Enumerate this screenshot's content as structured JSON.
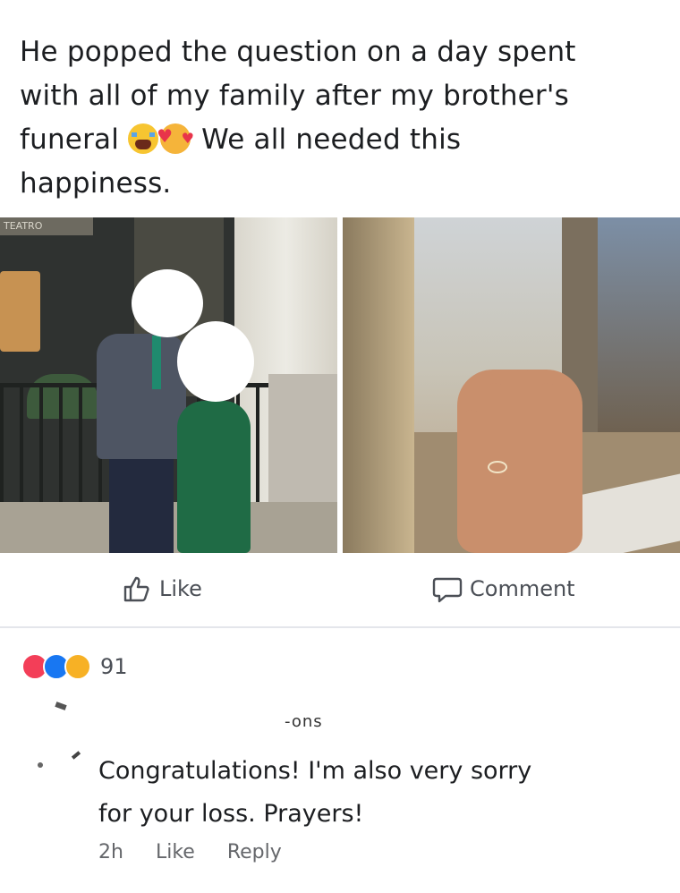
{
  "post": {
    "text_line1": "He popped the question on a day spent",
    "text_line2": "with all of my family after my brother's",
    "text_line3_a": "funeral",
    "text_line3_b": "We all needed this",
    "text_line4": "happiness.",
    "emoji_1": "crying-face-icon",
    "emoji_2": "smiling-face-with-hearts-icon"
  },
  "photos": {
    "left_sign_text": "TEATRO"
  },
  "actions": {
    "like_label": "Like",
    "comment_label": "Comment"
  },
  "reactions": {
    "icons": [
      "love-reaction-icon",
      "like-reaction-icon",
      "care-reaction-icon"
    ],
    "count": "91"
  },
  "comment": {
    "name_fragment": "-ons",
    "text_line1": "Congratulations! I'm also very sorry",
    "text_line2": "for your loss. Prayers!",
    "time": "2h",
    "like_label": "Like",
    "reply_label": "Reply"
  },
  "colors": {
    "text": "#1c1e21",
    "muted": "#65676b",
    "like_blue": "#1877f2",
    "love_red": "#f33e58"
  }
}
